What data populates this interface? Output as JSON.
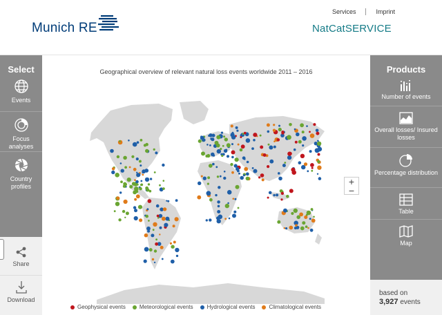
{
  "header": {
    "logo_text": "Munich RE",
    "brand": "NatCatSERVICE",
    "links": [
      "Services",
      "Imprint"
    ]
  },
  "left_sidebar": {
    "title": "Select",
    "items": [
      {
        "label": "Events",
        "icon": "globe-icon"
      },
      {
        "label": "Focus analyses",
        "icon": "target-icon"
      },
      {
        "label": "Country profiles",
        "icon": "aperture-icon"
      }
    ],
    "bottom_items": [
      {
        "label": "Share",
        "icon": "share-icon"
      },
      {
        "label": "Download",
        "icon": "download-icon"
      }
    ]
  },
  "right_sidebar": {
    "title": "Products",
    "items": [
      {
        "label": "Number of events",
        "icon": "bar-chart-icon"
      },
      {
        "label": "Overall losses/ Insured losses",
        "icon": "area-chart-icon"
      },
      {
        "label": "Percentage distribution",
        "icon": "pie-chart-icon"
      },
      {
        "label": "Table",
        "icon": "table-icon"
      },
      {
        "label": "Map",
        "icon": "map-icon",
        "active": true
      }
    ],
    "based_on_label": "based on",
    "event_count": "3,927",
    "event_unit": "events"
  },
  "map": {
    "title": "Geographical overview of relevant natural loss events worldwide 2011 – 2016",
    "zoom_in": "+",
    "zoom_out": "−"
  },
  "legend": [
    {
      "label": "Geophysical events",
      "color": "#c0161d"
    },
    {
      "label": "Meteorological events",
      "color": "#6aa532"
    },
    {
      "label": "Hydrological events",
      "color": "#1f5fa8"
    },
    {
      "label": "Climatological events",
      "color": "#e07b1a"
    }
  ],
  "colors": {
    "sidebar": "#8a8a8a",
    "land": "#d8d8d8",
    "brand_teal": "#137a86",
    "logo_blue": "#003c78"
  }
}
